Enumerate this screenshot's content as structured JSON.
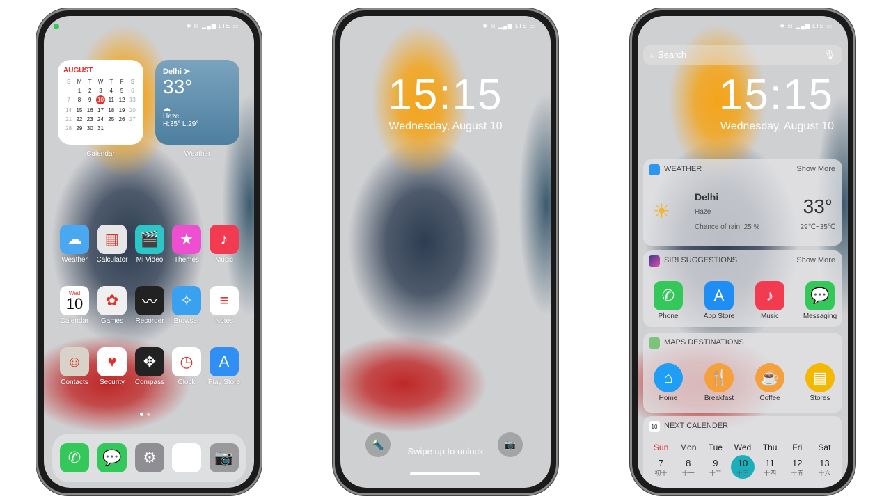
{
  "status": {
    "network": "LTE"
  },
  "home": {
    "calendar_widget": {
      "month": "AUGUST",
      "weekdays": [
        "S",
        "M",
        "T",
        "W",
        "T",
        "F",
        "S"
      ],
      "weeks": [
        [
          "",
          "1",
          "2",
          "3",
          "4",
          "5",
          "6"
        ],
        [
          "7",
          "8",
          "9",
          "10",
          "11",
          "12",
          "13"
        ],
        [
          "14",
          "15",
          "16",
          "17",
          "18",
          "19",
          "20"
        ],
        [
          "21",
          "22",
          "23",
          "24",
          "25",
          "26",
          "27"
        ],
        [
          "28",
          "29",
          "30",
          "31",
          "",
          "",
          ""
        ]
      ],
      "today": "10",
      "label": "Calendar"
    },
    "weather_widget": {
      "city": "Delhi",
      "temp": "33°",
      "condition": "Haze",
      "hilo": "H:35°  L:29°",
      "label": "Weather"
    },
    "apps": [
      {
        "label": "Weather",
        "color": "#4aa8f0",
        "glyph": "☁"
      },
      {
        "label": "Calculator",
        "color": "#e6e6e6",
        "glyph": "▦"
      },
      {
        "label": "Mi Video",
        "color": "#2bc6c8",
        "glyph": "🎬"
      },
      {
        "label": "Themes",
        "color": "#ee4fd0",
        "glyph": "★"
      },
      {
        "label": "Music",
        "color": "#f23a50",
        "glyph": "♪"
      },
      {
        "label": "Calendar",
        "color": "#ffffff",
        "glyph": ""
      },
      {
        "label": "Games",
        "color": "#f0f0f0",
        "glyph": "✿"
      },
      {
        "label": "Recorder",
        "color": "#222222",
        "glyph": "〰"
      },
      {
        "label": "Browser",
        "color": "#3aa0f0",
        "glyph": "✧"
      },
      {
        "label": "Notes",
        "color": "#ffffff",
        "glyph": "≡"
      },
      {
        "label": "Contacts",
        "color": "#d8d2c8",
        "glyph": "☺"
      },
      {
        "label": "Security",
        "color": "#ffffff",
        "glyph": "♥"
      },
      {
        "label": "Compass",
        "color": "#222222",
        "glyph": "✥"
      },
      {
        "label": "Clock",
        "color": "#ffffff",
        "glyph": "◷"
      },
      {
        "label": "Play Store",
        "color": "#2f8ff5",
        "glyph": "A"
      }
    ],
    "calendar_icon": {
      "day": "Wed",
      "date": "10"
    },
    "dock": [
      {
        "name": "phone",
        "color": "#34c759",
        "glyph": "✆"
      },
      {
        "name": "messages",
        "color": "#34c759",
        "glyph": "💬"
      },
      {
        "name": "settings",
        "color": "#8e8e93",
        "glyph": "⚙"
      },
      {
        "name": "photos",
        "color": "#ffffff",
        "glyph": "✿"
      },
      {
        "name": "camera",
        "color": "#9a9a9a",
        "glyph": "📷"
      }
    ]
  },
  "lock": {
    "time": "15:15",
    "date": "Wednesday, August 10",
    "hint": "Swipe up to unlock"
  },
  "today": {
    "search_placeholder": "Search",
    "time": "15:15",
    "date": "Wednesday, August 10",
    "weather": {
      "title": "WEATHER",
      "more": "Show More",
      "city": "Delhi",
      "condition": "Haze",
      "rain": "Chance of rain: 25 %",
      "temp": "33°",
      "range": "29℃~35℃"
    },
    "siri": {
      "title": "SIRI SUGGESTIONS",
      "more": "Show More",
      "apps": [
        {
          "label": "Phone",
          "color": "#34c759",
          "glyph": "✆"
        },
        {
          "label": "App Store",
          "color": "#1e8ef5",
          "glyph": "A"
        },
        {
          "label": "Music",
          "color": "#f23a50",
          "glyph": "♪"
        },
        {
          "label": "Messaging",
          "color": "#34c759",
          "glyph": "💬"
        }
      ]
    },
    "maps": {
      "title": "MAPS DESTINATIONS",
      "items": [
        {
          "label": "Home",
          "color": "#1e9ef5",
          "glyph": "⌂"
        },
        {
          "label": "Breakfast",
          "color": "#f5a03a",
          "glyph": "🍴"
        },
        {
          "label": "Coffee",
          "color": "#f5a03a",
          "glyph": "☕"
        },
        {
          "label": "Stores",
          "color": "#f5b800",
          "glyph": "▤"
        }
      ]
    },
    "calendar": {
      "title": "NEXT CALENDER",
      "icon_date": "10",
      "days": [
        {
          "d": "Sun",
          "n": "7",
          "l": "初十"
        },
        {
          "d": "Mon",
          "n": "8",
          "l": "十一"
        },
        {
          "d": "Tue",
          "n": "9",
          "l": "十二"
        },
        {
          "d": "Wed",
          "n": "10",
          "l": "十三"
        },
        {
          "d": "Thu",
          "n": "11",
          "l": "十四"
        },
        {
          "d": "Fri",
          "n": "12",
          "l": "十五"
        },
        {
          "d": "Sat",
          "n": "13",
          "l": "十六"
        }
      ],
      "selected": "Wed",
      "accent": "#1ab0bb"
    }
  }
}
